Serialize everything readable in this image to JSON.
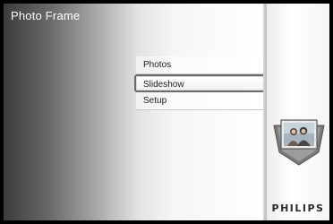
{
  "app": {
    "title": "Photo Frame"
  },
  "menu": {
    "items": [
      {
        "label": "Photos"
      },
      {
        "label": "Slideshow",
        "selected": true
      },
      {
        "label": "Setup"
      }
    ]
  },
  "sidebar": {
    "icon": "photo-frame-icon",
    "brand": "PHILIPS"
  }
}
